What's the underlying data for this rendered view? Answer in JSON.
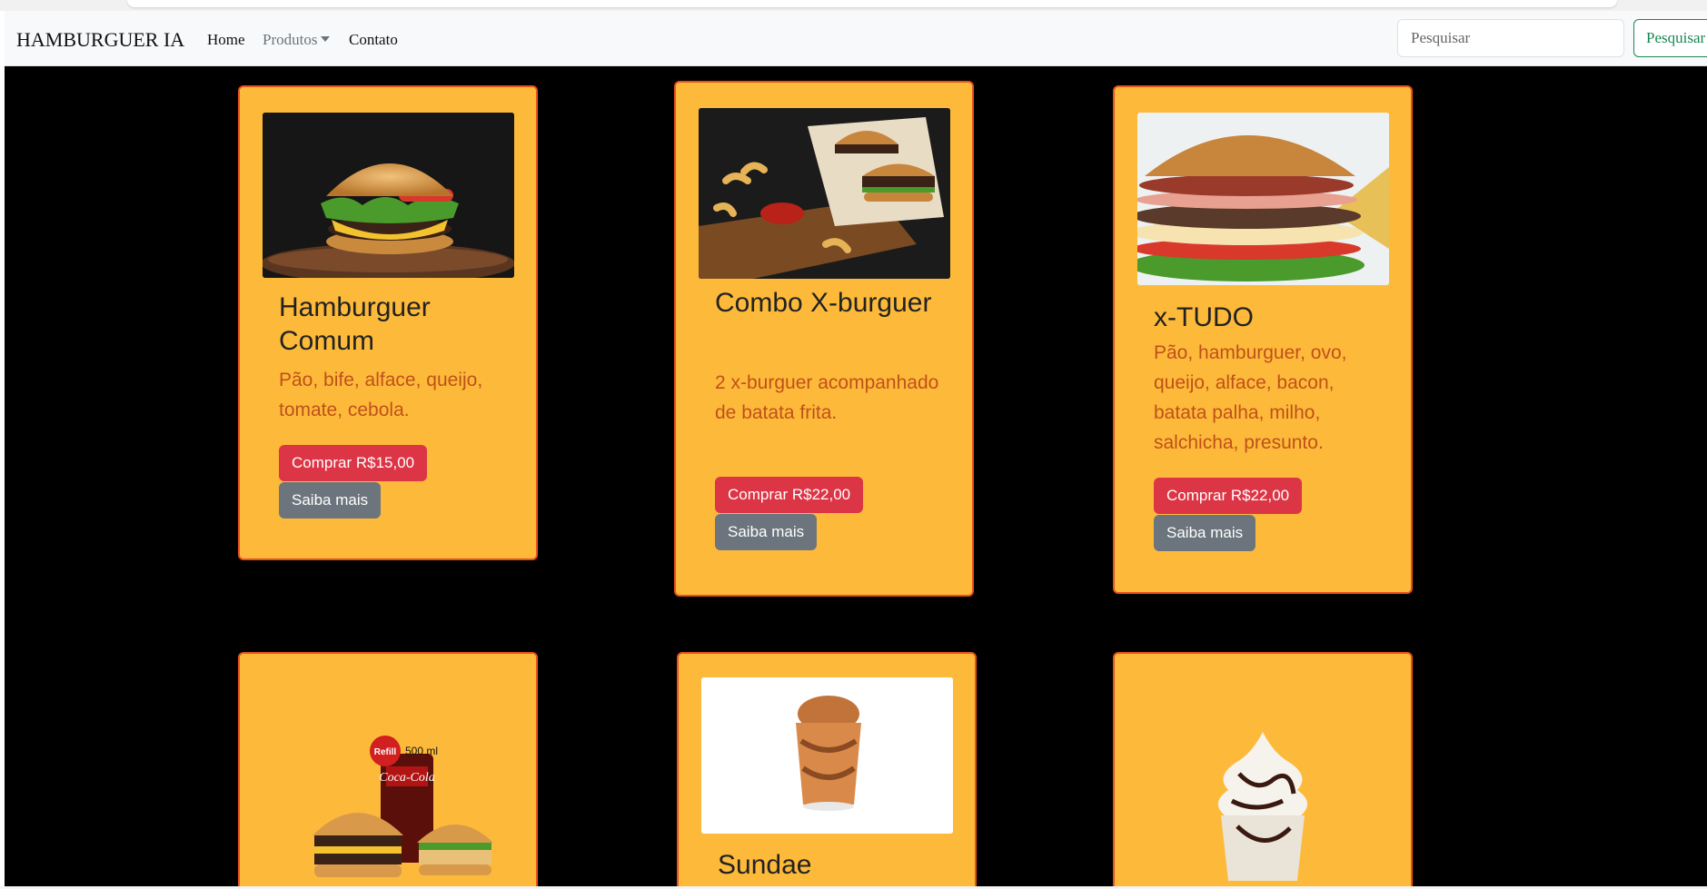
{
  "navbar": {
    "brand": "HAMBURGUER IA",
    "links": [
      {
        "label": "Home"
      },
      {
        "label": "Produtos"
      },
      {
        "label": "Contato"
      }
    ],
    "search_placeholder": "Pesquisar",
    "search_button": "Pesquisar"
  },
  "products": [
    {
      "title": "Hamburguer Comum",
      "description": "Pão, bife, alface, queijo, tomate, cebola.",
      "buy_label": "Comprar R$15,00",
      "more_label": "Saiba mais"
    },
    {
      "title": "Combo X-burguer",
      "description": "2 x-burguer acompanhado de batata frita.",
      "buy_label": "Comprar R$22,00",
      "more_label": "Saiba mais"
    },
    {
      "title": "x-TUDO",
      "description": "Pão, hamburguer, ovo, queijo, alface, bacon, batata palha, milho, salchicha, presunto.",
      "buy_label": "Comprar R$22,00",
      "more_label": "Saiba mais"
    },
    {
      "title": "",
      "description": "",
      "image_text": {
        "badge": "Refill",
        "size": "500 ml",
        "brand": "Coca-Cola"
      }
    },
    {
      "title": "Sundae"
    },
    {
      "title": ""
    }
  ],
  "colors": {
    "card_bg": "#fdba3a",
    "card_border": "#e8501e",
    "buy_button": "#dc3545",
    "more_button": "#6c757d",
    "description_text": "#c0501a",
    "search_button": "#198754",
    "page_bg": "#000000"
  }
}
